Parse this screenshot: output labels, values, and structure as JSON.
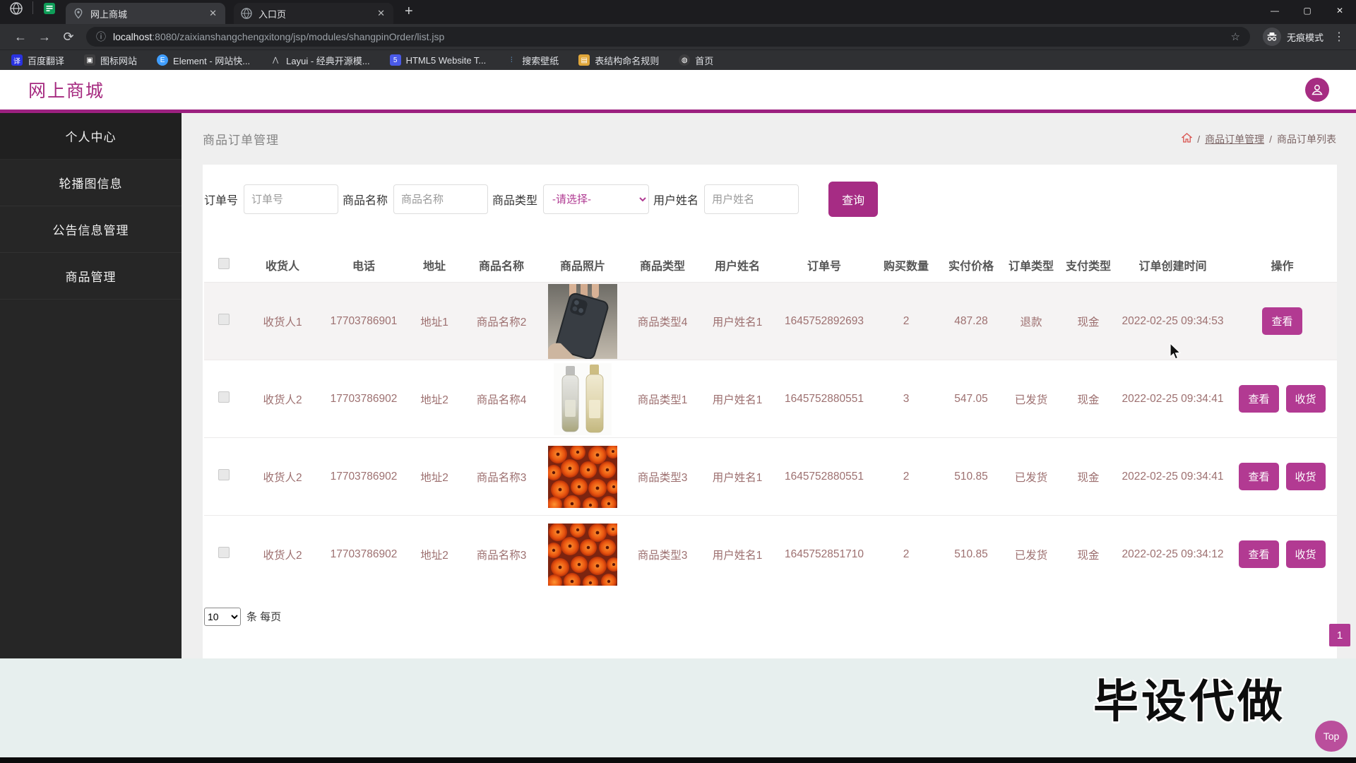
{
  "browser": {
    "tabs": [
      {
        "title": "网上商城"
      },
      {
        "title": "入口页"
      }
    ],
    "url_host": "localhost",
    "url_rest": ":8080/zaixianshangchengxitong/jsp/modules/shangpinOrder/list.jsp",
    "incognito_label": "无痕模式",
    "bookmarks": [
      "百度翻译",
      "图标网站",
      "Element - 网站快...",
      "Layui - 经典开源模...",
      "HTML5 Website T...",
      "搜索壁纸",
      "表结构命名规则",
      "首页"
    ]
  },
  "icons": {
    "back": "←",
    "forward": "→",
    "reload": "⟳",
    "info": "ⓘ",
    "star": "☆",
    "more": "⋮",
    "minimize": "—",
    "maximize": "▢",
    "close": "✕",
    "tab_close": "✕",
    "new_tab": "+",
    "dropdown_caret": "∨"
  },
  "header": {
    "logo": "网上商城"
  },
  "sidebar": {
    "items": [
      "个人中心",
      "轮播图信息",
      "公告信息管理",
      "商品管理"
    ]
  },
  "page": {
    "title": "商品订单管理",
    "breadcrumb_sep": "/",
    "breadcrumb": [
      "商品订单管理",
      "商品订单列表"
    ]
  },
  "filters": {
    "order_no_label": "订单号",
    "order_no_placeholder": "订单号",
    "product_name_label": "商品名称",
    "product_name_placeholder": "商品名称",
    "product_type_label": "商品类型",
    "product_type_value": "-请选择-",
    "user_name_label": "用户姓名",
    "user_name_placeholder": "用户姓名",
    "search_button": "查询"
  },
  "table": {
    "headers": [
      "收货人",
      "电话",
      "地址",
      "商品名称",
      "商品照片",
      "商品类型",
      "用户姓名",
      "订单号",
      "购买数量",
      "实付价格",
      "订单类型",
      "支付类型",
      "订单创建时间",
      "操作"
    ],
    "rows": [
      {
        "consignee": "收货人1",
        "phone": "17703786901",
        "address": "地址1",
        "product_name": "商品名称2",
        "photo": "phone",
        "product_type": "商品类型4",
        "user_name": "用户姓名1",
        "order_no": "1645752892693",
        "quantity": "2",
        "price": "487.28",
        "order_type": "退款",
        "pay_type": "现金",
        "created": "2022-02-25 09:34:53",
        "actions": [
          "查看"
        ]
      },
      {
        "consignee": "收货人2",
        "phone": "17703786902",
        "address": "地址2",
        "product_name": "商品名称4",
        "photo": "bottles",
        "product_type": "商品类型1",
        "user_name": "用户姓名1",
        "order_no": "1645752880551",
        "quantity": "3",
        "price": "547.05",
        "order_type": "已发货",
        "pay_type": "现金",
        "created": "2022-02-25 09:34:41",
        "actions": [
          "查看",
          "收货"
        ]
      },
      {
        "consignee": "收货人2",
        "phone": "17703786902",
        "address": "地址2",
        "product_name": "商品名称3",
        "photo": "flowers",
        "product_type": "商品类型3",
        "user_name": "用户姓名1",
        "order_no": "1645752880551",
        "quantity": "2",
        "price": "510.85",
        "order_type": "已发货",
        "pay_type": "现金",
        "created": "2022-02-25 09:34:41",
        "actions": [
          "查看",
          "收货"
        ]
      },
      {
        "consignee": "收货人2",
        "phone": "17703786902",
        "address": "地址2",
        "product_name": "商品名称3",
        "photo": "flowers",
        "product_type": "商品类型3",
        "user_name": "用户姓名1",
        "order_no": "1645752851710",
        "quantity": "2",
        "price": "510.85",
        "order_type": "已发货",
        "pay_type": "现金",
        "created": "2022-02-25 09:34:12",
        "actions": [
          "查看",
          "收货"
        ]
      }
    ]
  },
  "pagination": {
    "per_page": "10",
    "suffix": "条 每页",
    "current_page": "1"
  },
  "footer": {
    "watermark": "毕设代做",
    "top_button": "Top"
  },
  "colors": {
    "primary": "#a62c84",
    "accent_line": "#9c2180",
    "row_text": "#9d7070",
    "footer_band": "#e7efee"
  }
}
